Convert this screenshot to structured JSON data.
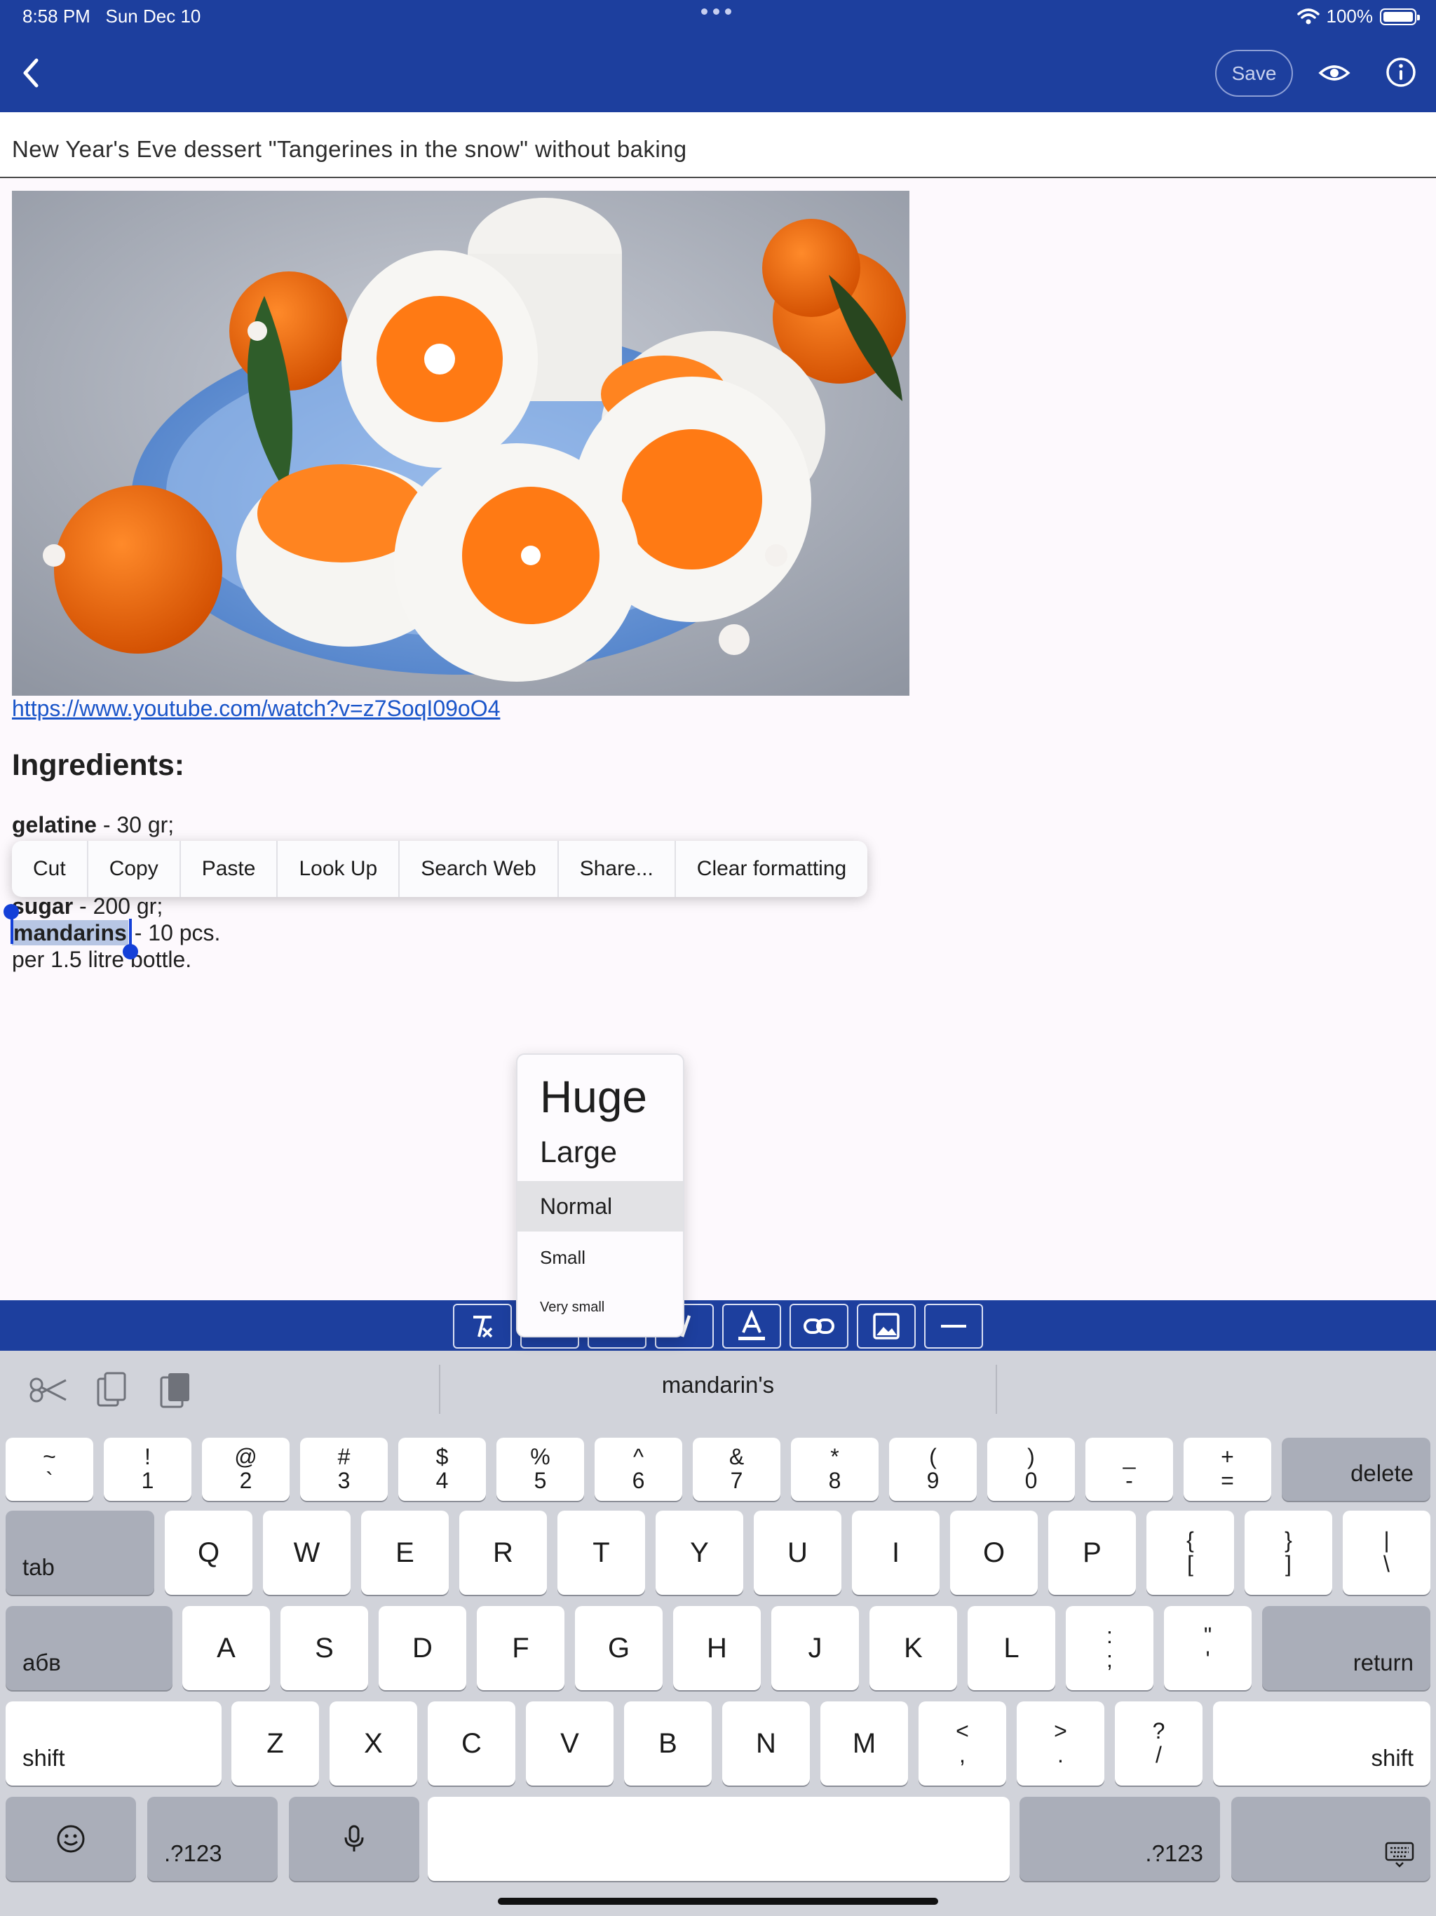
{
  "status_bar": {
    "time": "8:58 PM",
    "date": "Sun Dec 10",
    "battery": "100%"
  },
  "app_bar": {
    "save_label": "Save"
  },
  "note": {
    "title": "New Year's Eve dessert \"Tangerines in the snow\" without baking",
    "link": "https://www.youtube.com/watch?v=z7SoqI09oO4",
    "heading": "Ingredients:",
    "lines": [
      {
        "bold": "gelatine",
        "rest": " - 30 gr;"
      },
      {
        "bold": "sugar",
        "rest": " - 200 gr;"
      },
      {
        "bold": "mandarins",
        "rest": " - 10 pcs."
      },
      {
        "bold": "",
        "rest": "per 1.5 litre bottle."
      }
    ]
  },
  "edit_menu": [
    "Cut",
    "Copy",
    "Paste",
    "Look Up",
    "Search Web",
    "Share...",
    "Clear formatting"
  ],
  "size_menu": {
    "huge": "Huge",
    "large": "Large",
    "normal": "Normal",
    "small": "Small",
    "very_small": "Very small",
    "selected": "Normal"
  },
  "keyboard": {
    "suggestion": "mandarin's",
    "row1": [
      {
        "top": "~",
        "bottom": "`"
      },
      {
        "top": "!",
        "bottom": "1"
      },
      {
        "top": "@",
        "bottom": "2"
      },
      {
        "top": "#",
        "bottom": "3"
      },
      {
        "top": "$",
        "bottom": "4"
      },
      {
        "top": "%",
        "bottom": "5"
      },
      {
        "top": "^",
        "bottom": "6"
      },
      {
        "top": "&",
        "bottom": "7"
      },
      {
        "top": "*",
        "bottom": "8"
      },
      {
        "top": "(",
        "bottom": "9"
      },
      {
        "top": ")",
        "bottom": "0"
      },
      {
        "top": "_",
        "bottom": "-"
      },
      {
        "top": "+",
        "bottom": "="
      }
    ],
    "delete": "delete",
    "tab": "tab",
    "row2": [
      "Q",
      "W",
      "E",
      "R",
      "T",
      "Y",
      "U",
      "I",
      "O",
      "P"
    ],
    "row2_sym": [
      {
        "top": "{",
        "bottom": "["
      },
      {
        "top": "}",
        "bottom": "]"
      },
      {
        "top": "|",
        "bottom": "\\"
      }
    ],
    "lang": "абв",
    "row3": [
      "A",
      "S",
      "D",
      "F",
      "G",
      "H",
      "J",
      "K",
      "L"
    ],
    "row3_sym": [
      {
        "top": ":",
        "bottom": ";"
      },
      {
        "top": "\"",
        "bottom": "'"
      }
    ],
    "return": "return",
    "shift": "shift",
    "row4": [
      "Z",
      "X",
      "C",
      "V",
      "B",
      "N",
      "M"
    ],
    "row4_sym": [
      {
        "top": "<",
        "bottom": ","
      },
      {
        "top": ">",
        "bottom": "."
      },
      {
        "top": "?",
        "bottom": "/"
      }
    ],
    "numbers": ".?123"
  },
  "colors": {
    "app_bar": "#1d3f9e",
    "link": "#1a55c9",
    "selection": "#b7c6e4",
    "handle": "#1440d8"
  }
}
